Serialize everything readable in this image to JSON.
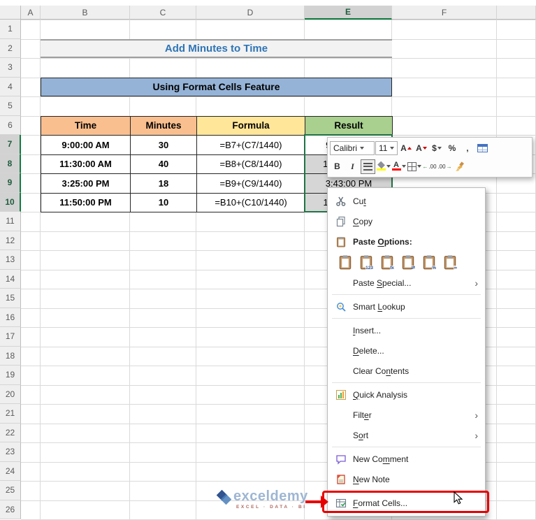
{
  "sheet": {
    "column_headers": [
      "A",
      "B",
      "C",
      "D",
      "E",
      "F",
      ""
    ],
    "row_count": 26,
    "selected_column_index": 4,
    "selected_row_numbers": [
      7,
      8,
      9,
      10
    ],
    "selection_range": "E7:E10",
    "title_banner": "Add Minutes to Time",
    "section_banner": "Using Format Cells Feature",
    "table": {
      "headers": [
        "Time",
        "Minutes",
        "Formula",
        "Result"
      ],
      "rows": [
        {
          "time": "9:00:00 AM",
          "minutes": "30",
          "formula": "=B7+(C7/1440)",
          "result": "9:30:00 AM"
        },
        {
          "time": "11:30:00 AM",
          "minutes": "40",
          "formula": "=B8+(C8/1440)",
          "result": "12:10:00 PM"
        },
        {
          "time": "3:25:00 PM",
          "minutes": "18",
          "formula": "=B9+(C9/1440)",
          "result": "3:43:00 PM"
        },
        {
          "time": "11:50:00 PM",
          "minutes": "10",
          "formula": "=B10+(C10/1440)",
          "result": "12:00:00 AM"
        }
      ]
    },
    "watermark": {
      "brand": "exceldemy",
      "tagline": "EXCEL · DATA · BI"
    }
  },
  "colors": {
    "accent_green": "#217346",
    "header_orange": "#FABF8F",
    "header_yellow": "#FFE699",
    "header_green": "#A9D08E",
    "banner_blue": "#95B3D7",
    "title_blue": "#2E74B5",
    "selection_gray": "#D6D6D6",
    "annotation_red": "#E80000"
  },
  "mini_toolbar": {
    "font_name": "Calibri",
    "font_size": "11",
    "row1": [
      {
        "name": "font-name-select",
        "type": "select",
        "bind": "font_name"
      },
      {
        "name": "font-size-select",
        "type": "select",
        "bind": "font_size"
      },
      {
        "name": "grow-font-icon",
        "glyph": "A",
        "mod": "up"
      },
      {
        "name": "shrink-font-icon",
        "glyph": "A",
        "mod": "down"
      },
      {
        "name": "accounting-format-icon",
        "glyph": "$",
        "caret": true
      },
      {
        "name": "percent-style-icon",
        "glyph": "%"
      },
      {
        "name": "comma-style-icon",
        "glyph": ","
      },
      {
        "name": "format-as-table-icon",
        "shape": "table"
      }
    ],
    "row2": [
      {
        "name": "bold-icon",
        "glyph": "B",
        "style": "bold"
      },
      {
        "name": "italic-icon",
        "glyph": "I",
        "style": "italic"
      },
      {
        "name": "center-align-icon",
        "shape": "align",
        "active": true
      },
      {
        "name": "fill-color-icon",
        "shape": "fill",
        "caret": true,
        "color": "#FFFF00"
      },
      {
        "name": "font-color-icon",
        "shape": "fontcolor",
        "glyph": "A",
        "caret": true,
        "color": "#FF0000"
      },
      {
        "name": "borders-icon",
        "shape": "borders",
        "caret": true
      },
      {
        "name": "increase-decimal-icon",
        "shape": "dec-inc"
      },
      {
        "name": "decrease-decimal-icon",
        "shape": "dec-dec"
      },
      {
        "name": "format-painter-icon",
        "shape": "brush"
      }
    ]
  },
  "context_menu": {
    "items": [
      {
        "id": "cut",
        "icon": "scissors-icon",
        "pre": "Cu",
        "u": "t",
        "post": ""
      },
      {
        "id": "copy",
        "icon": "copy-icon",
        "pre": "",
        "u": "C",
        "post": "opy"
      },
      {
        "id": "paste-options",
        "icon": "clipboard-icon",
        "pre": "Paste ",
        "u": "O",
        "post": "ptions:",
        "bold": true
      },
      {
        "id": "paste-icons",
        "type": "paste-row",
        "options": [
          "paste-icon",
          "paste-values-icon",
          "paste-formulas-icon",
          "paste-transpose-icon",
          "paste-formatting-icon",
          "paste-link-icon"
        ],
        "subglyphs": [
          "",
          "123",
          "fx",
          "⇄",
          "%",
          "∞"
        ]
      },
      {
        "id": "paste-special",
        "pre": "Paste ",
        "u": "S",
        "post": "pecial...",
        "chevron": true,
        "sep_after": true
      },
      {
        "id": "smart-lookup",
        "icon": "smart-lookup-icon",
        "pre": "Smart ",
        "u": "L",
        "post": "ookup",
        "sep_after": true
      },
      {
        "id": "insert",
        "pre": "",
        "u": "I",
        "post": "nsert..."
      },
      {
        "id": "delete",
        "pre": "",
        "u": "D",
        "post": "elete..."
      },
      {
        "id": "clear-contents",
        "pre": "Clear Co",
        "u": "n",
        "post": "tents",
        "sep_after": true
      },
      {
        "id": "quick-analysis",
        "icon": "quick-analysis-icon",
        "pre": "",
        "u": "Q",
        "post": "uick Analysis"
      },
      {
        "id": "filter",
        "pre": "Filt",
        "u": "e",
        "post": "r",
        "chevron": true
      },
      {
        "id": "sort",
        "pre": "S",
        "u": "o",
        "post": "rt",
        "chevron": true,
        "sep_after": true
      },
      {
        "id": "new-comment",
        "icon": "comment-icon",
        "pre": "New Co",
        "u": "m",
        "post": "ment"
      },
      {
        "id": "new-note",
        "icon": "note-icon",
        "pre": "",
        "u": "N",
        "post": "ew Note",
        "sep_after": true
      },
      {
        "id": "format-cells",
        "icon": "format-cells-icon",
        "pre": "",
        "u": "F",
        "post": "ormat Cells...",
        "highlighted": true
      }
    ]
  }
}
